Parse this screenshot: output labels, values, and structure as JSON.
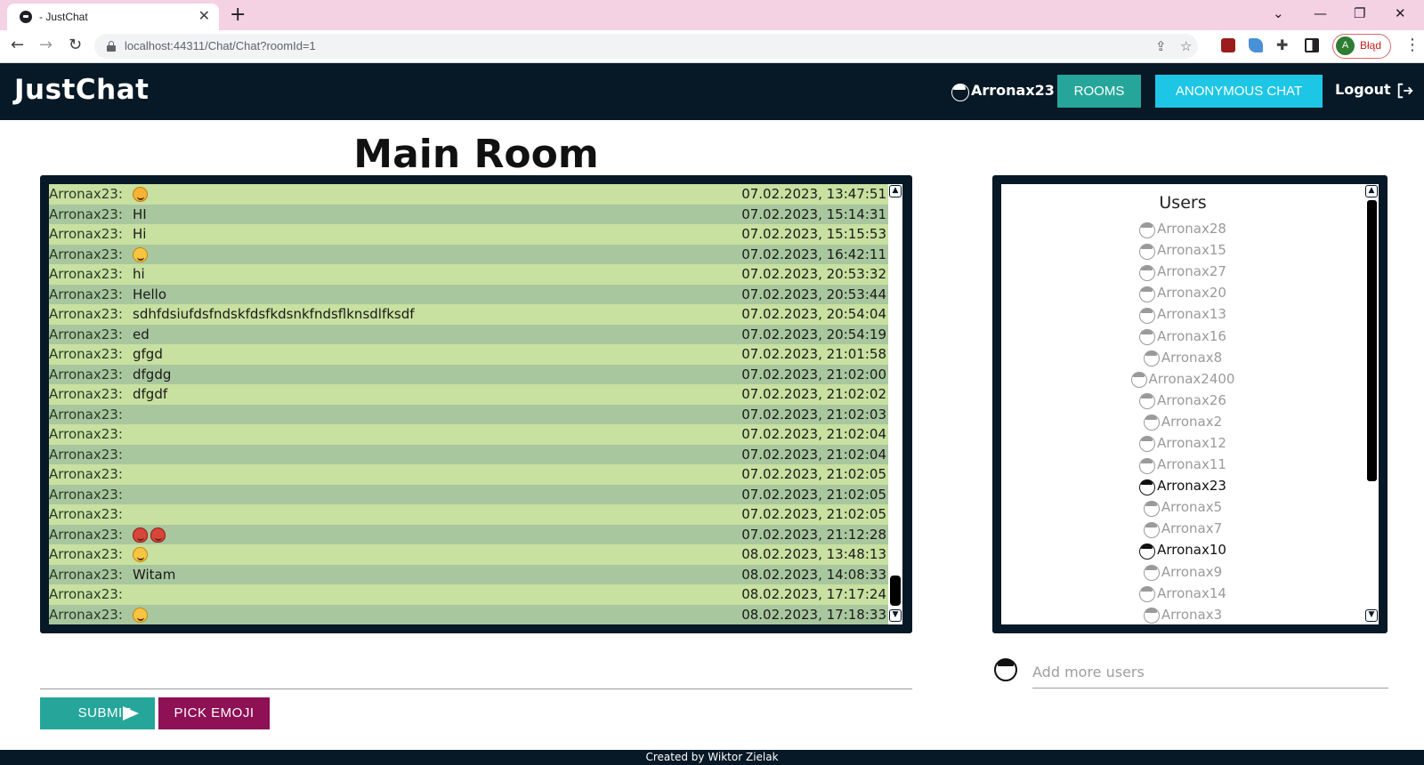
{
  "browser": {
    "tab_title": " - JustChat",
    "url": "localhost:44311/Chat/Chat?roomId=1",
    "profile_initial": "A",
    "profile_label": "Błąd"
  },
  "navbar": {
    "brand": "JustChat",
    "username": "Arronax23",
    "rooms_label": "ROOMS",
    "anonymous_label": "ANONYMOUS CHAT",
    "logout_label": "Logout"
  },
  "room": {
    "title": "Main Room"
  },
  "messages": [
    {
      "user": "Arronax23:",
      "text": "",
      "emoji": [
        "star"
      ],
      "time": "07.02.2023, 13:47:51"
    },
    {
      "user": "Arronax23:",
      "text": "HI",
      "emoji": [],
      "time": "07.02.2023, 15:14:31"
    },
    {
      "user": "Arronax23:",
      "text": "Hi",
      "emoji": [],
      "time": "07.02.2023, 15:15:53"
    },
    {
      "user": "Arronax23:",
      "text": "",
      "emoji": [
        "grin"
      ],
      "time": "07.02.2023, 16:42:11"
    },
    {
      "user": "Arronax23:",
      "text": "hi",
      "emoji": [],
      "time": "07.02.2023, 20:53:32"
    },
    {
      "user": "Arronax23:",
      "text": "Hello",
      "emoji": [],
      "time": "07.02.2023, 20:53:44"
    },
    {
      "user": "Arronax23:",
      "text": "sdhfdsiufdsfndskfdsfkdsnkfndsflknsdlfksdf",
      "emoji": [],
      "time": "07.02.2023, 20:54:04"
    },
    {
      "user": "Arronax23:",
      "text": "ed",
      "emoji": [],
      "time": "07.02.2023, 20:54:19"
    },
    {
      "user": "Arronax23:",
      "text": "gfgd",
      "emoji": [],
      "time": "07.02.2023, 21:01:58"
    },
    {
      "user": "Arronax23:",
      "text": "dfgdg",
      "emoji": [],
      "time": "07.02.2023, 21:02:00"
    },
    {
      "user": "Arronax23:",
      "text": "dfgdf",
      "emoji": [],
      "time": "07.02.2023, 21:02:02"
    },
    {
      "user": "Arronax23:",
      "text": "",
      "emoji": [],
      "time": "07.02.2023, 21:02:03"
    },
    {
      "user": "Arronax23:",
      "text": "",
      "emoji": [],
      "time": "07.02.2023, 21:02:04"
    },
    {
      "user": "Arronax23:",
      "text": "",
      "emoji": [],
      "time": "07.02.2023, 21:02:04"
    },
    {
      "user": "Arronax23:",
      "text": "",
      "emoji": [],
      "time": "07.02.2023, 21:02:05"
    },
    {
      "user": "Arronax23:",
      "text": "",
      "emoji": [],
      "time": "07.02.2023, 21:02:05"
    },
    {
      "user": "Arronax23:",
      "text": "",
      "emoji": [],
      "time": "07.02.2023, 21:02:05"
    },
    {
      "user": "Arronax23:",
      "text": "",
      "emoji": [
        "devil",
        "devil"
      ],
      "time": "07.02.2023, 21:12:28"
    },
    {
      "user": "Arronax23:",
      "text": "",
      "emoji": [
        "grin"
      ],
      "time": "08.02.2023, 13:48:13"
    },
    {
      "user": "Arronax23:",
      "text": "Witam",
      "emoji": [],
      "time": "08.02.2023, 14:08:33"
    },
    {
      "user": "Arronax23:",
      "text": "",
      "emoji": [],
      "time": "08.02.2023, 17:17:24"
    },
    {
      "user": "Arronax23:",
      "text": "",
      "emoji": [
        "smile"
      ],
      "time": "08.02.2023, 17:18:33"
    }
  ],
  "users_panel": {
    "title": "Users",
    "users": [
      {
        "name": "Arronax28",
        "online": false
      },
      {
        "name": "Arronax15",
        "online": false
      },
      {
        "name": "Arronax27",
        "online": false
      },
      {
        "name": "Arronax20",
        "online": false
      },
      {
        "name": "Arronax13",
        "online": false
      },
      {
        "name": "Arronax16",
        "online": false
      },
      {
        "name": "Arronax8",
        "online": false
      },
      {
        "name": "Arronax2400",
        "online": false
      },
      {
        "name": "Arronax26",
        "online": false
      },
      {
        "name": "Arronax2",
        "online": false
      },
      {
        "name": "Arronax12",
        "online": false
      },
      {
        "name": "Arronax11",
        "online": false
      },
      {
        "name": "Arronax23",
        "online": true
      },
      {
        "name": "Arronax5",
        "online": false
      },
      {
        "name": "Arronax7",
        "online": false
      },
      {
        "name": "Arronax10",
        "online": true
      },
      {
        "name": "Arronax9",
        "online": false
      },
      {
        "name": "Arronax14",
        "online": false
      },
      {
        "name": "Arronax3",
        "online": false
      }
    ]
  },
  "composer": {
    "submit_label": "SUBMIT",
    "emoji_label": "PICK EMOJI"
  },
  "add_users": {
    "placeholder": "Add more users"
  },
  "footer": {
    "text": "Created by Wiktor Zielak"
  },
  "colors": {
    "navbar_bg": "#071826",
    "rooms_button": "#26a69a",
    "anonymous_button": "#1ec6e6",
    "emoji_button": "#8e1055",
    "message_row_light": "#c8e0a0",
    "message_row_dark": "#a9c79e"
  }
}
